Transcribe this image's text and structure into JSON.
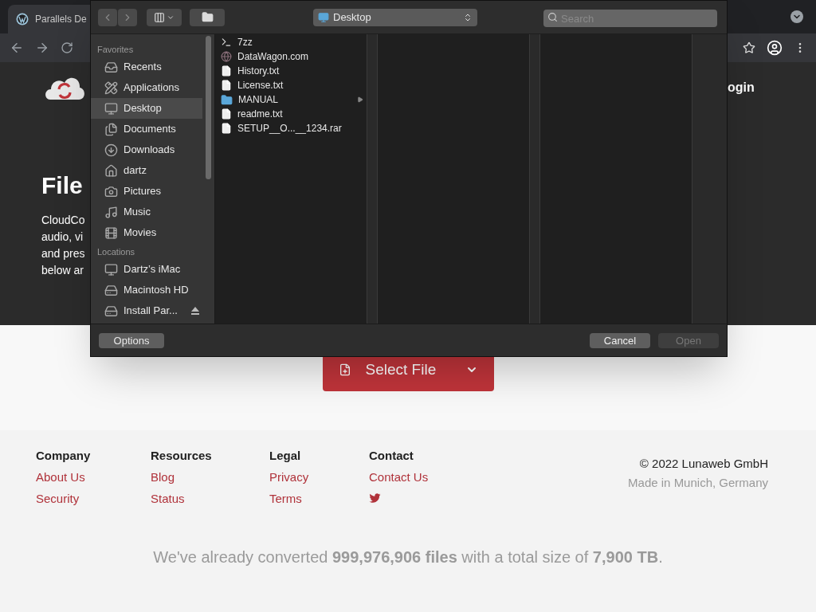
{
  "browser": {
    "tab_title": "Parallels De"
  },
  "page": {
    "login": "ogin",
    "heading": "File",
    "text_lines": [
      "CloudCo",
      "audio, vi",
      "and pres",
      "below ar"
    ],
    "select_button": "Select File"
  },
  "dialog": {
    "location": "Desktop",
    "search": {
      "placeholder": "Search"
    },
    "sidebar": [
      {
        "title": "Favorites",
        "items": [
          {
            "label": "Recents",
            "selected": false
          },
          {
            "label": "Applications",
            "selected": false
          },
          {
            "label": "Desktop",
            "selected": true
          },
          {
            "label": "Documents",
            "selected": false
          },
          {
            "label": "Downloads",
            "selected": false
          },
          {
            "label": "dartz",
            "selected": false
          },
          {
            "label": "Pictures",
            "selected": false
          },
          {
            "label": "Music",
            "selected": false
          },
          {
            "label": "Movies",
            "selected": false
          }
        ]
      },
      {
        "title": "Locations",
        "items": [
          {
            "label": "Dartz’s iMac",
            "selected": false
          },
          {
            "label": "Macintosh HD",
            "selected": false
          },
          {
            "label": "Install Par...",
            "selected": false,
            "ejectable": true
          }
        ]
      }
    ],
    "files": [
      {
        "name": "7zz",
        "kind": "executable"
      },
      {
        "name": "DataWagon.com",
        "kind": "web"
      },
      {
        "name": "History.txt",
        "kind": "file"
      },
      {
        "name": "License.txt",
        "kind": "file"
      },
      {
        "name": "MANUAL",
        "kind": "folder"
      },
      {
        "name": "readme.txt",
        "kind": "file"
      },
      {
        "name": "SETUP__O...__1234.rar",
        "kind": "file"
      }
    ],
    "buttons": {
      "options": "Options",
      "cancel": "Cancel",
      "open": "Open",
      "open_disabled": true
    }
  },
  "footer": {
    "columns": [
      {
        "title": "Company",
        "links": [
          "About Us",
          "Security"
        ]
      },
      {
        "title": "Resources",
        "links": [
          "Blog",
          "Status"
        ]
      },
      {
        "title": "Legal",
        "links": [
          "Privacy",
          "Terms"
        ]
      },
      {
        "title": "Contact",
        "links": [
          "Contact Us"
        ],
        "twitter": true
      }
    ],
    "copyright": "© 2022 Lunaweb GmbH",
    "made_in": "Made in Munich, Germany",
    "stats": "We've already converted **999,976,906 files** with a total size of **7,900 TB**."
  }
}
